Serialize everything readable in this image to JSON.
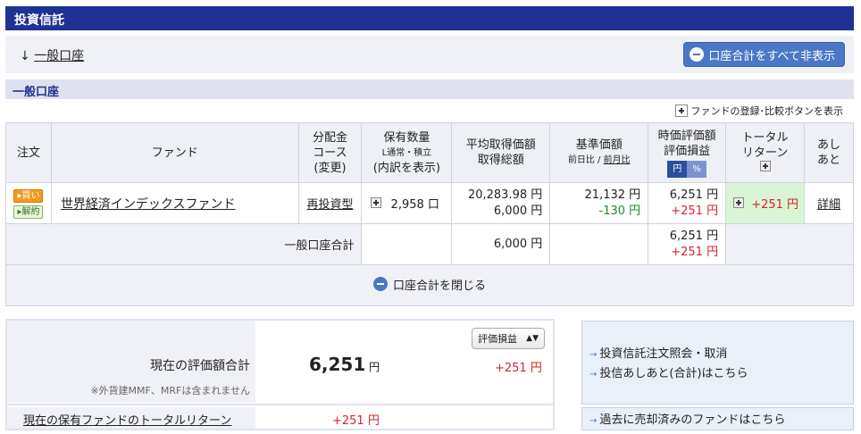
{
  "header": {
    "title": "投資信託"
  },
  "account_bar": {
    "arrow": "↓",
    "link": "一般口座",
    "hide_all_button": "口座合計をすべて非表示"
  },
  "section": {
    "title": "一般口座"
  },
  "fund_register": {
    "label": "ファンドの登録･比較ボタンを表示"
  },
  "table": {
    "headers": {
      "order": "注文",
      "fund": "ファンド",
      "dist_1": "分配金",
      "dist_2": "コース",
      "dist_3": "(変更)",
      "qty_1": "保有数量",
      "qty_2": "L通常・積立",
      "qty_3": "(内訳を表示)",
      "avg_1": "平均取得価額",
      "avg_2": "取得総額",
      "base_1": "基準価額",
      "base_2a": "前日比 / ",
      "base_2b": "前月比",
      "mv_1": "時価評価額",
      "mv_2": "評価損益",
      "mv_toggle_yen": "円",
      "mv_toggle_pct": "%",
      "tr_1": "トータル",
      "tr_2": "リターン",
      "ashiato_1": "あし",
      "ashiato_2": "あと"
    },
    "row": {
      "buy": "▸買い",
      "sell": "▸解約",
      "fund_name": "世界経済インデックスファンド",
      "course": "再投資型",
      "qty": "2,958 口",
      "avg_price": "20,283.98 円",
      "total_cost": "6,000 円",
      "base_price": "21,132 円",
      "day_change": "-130 円",
      "market_value": "6,251 円",
      "pl": "+251 円",
      "total_return": "+251 円",
      "detail": "詳細"
    },
    "subtotal": {
      "label": "一般口座合計",
      "total_cost": "6,000 円",
      "market_value": "6,251 円",
      "pl": "+251 円"
    },
    "close_label": "口座合計を閉じる"
  },
  "summary": {
    "label": "現在の評価額合計",
    "note": "※外貨建MMF、MRFは含まれません",
    "value": "6,251",
    "unit": "円",
    "select": "評価損益",
    "diff": "+251 円",
    "total_return_label": "現在の保有ファンドのトータルリターン",
    "total_return_value": "+251 円"
  },
  "links": {
    "item1": "投資信託注文照会・取消",
    "item2": "投信あしあと(合計)はこちら",
    "item3": "過去に売却済みのファンドはこちら"
  }
}
